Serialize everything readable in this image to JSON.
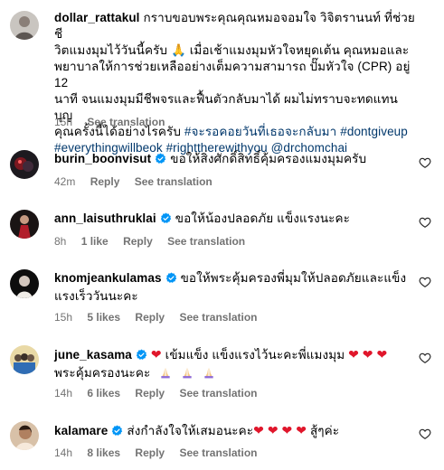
{
  "caption": {
    "username": "dollar_rattakul",
    "text_1": "กราบขอบพระคุณคุณหมอจอมใจ วิจิตรานนท์ ที่ช่วยชี",
    "text_2": "วิตแมงมุมไว้วันนี้ครับ 🙏 เมื่อเช้าแมงมุมหัวใจหยุดเต้น คุณหมอและ",
    "text_3": "พยาบาลให้การช่วยเหลืออย่างเต็มความสามารถ ปั๊มหัวใจ (CPR) อยู่ 12",
    "text_4": "นาที จนแมงมุมมีชีพจรและฟื้นตัวกลับมาได้ ผมไม่ทราบจะทดแทนบุญ",
    "text_5": "คุณครั้งนี้ได้อย่างไรครับ",
    "hashtag_1": "#จะรอคอยวันที่เธอจะกลับมา",
    "hashtag_2": "#dontgiveup",
    "hashtag_3": "#everythingwillbeok",
    "hashtag_4": "#righttherewithyou",
    "mention": "@drchomchai",
    "time": "15h",
    "translation": "See translation"
  },
  "comments": [
    {
      "username": "burin_boonvisut",
      "text": "ขอให้สิ่งศักดิ์สิทธิ์คุ้มครองแมงมุมครับ",
      "time": "42m",
      "reply": "Reply",
      "translation": "See translation"
    },
    {
      "username": "ann_laisuthruklai",
      "text": "ขอให้น้องปลอดภัย แข็งแรงนะคะ",
      "time": "8h",
      "likes": "1 like",
      "reply": "Reply",
      "translation": "See translation"
    },
    {
      "username": "knomjeankulamas",
      "text_1": "ขอให้พระคุ้มครองพี่มุมให้ปลอดภัยและแข็ง",
      "text_2": "แรงเร็ววันนะคะ",
      "time": "15h",
      "likes": "5 likes",
      "reply": "Reply",
      "translation": "See translation"
    },
    {
      "username": "june_kasama",
      "text_1a": "เข้มแข็ง แข็งแรงไว้นะคะพี่แมงมุม",
      "text_2": "พระคุ้มครองนะคะ",
      "time": "14h",
      "likes": "6 likes",
      "reply": "Reply",
      "translation": "See translation"
    },
    {
      "username": "kalamare",
      "text_a": "ส่งกำลังใจให้เสมอนะคะ",
      "text_b": "สู้ๆค่ะ",
      "time": "14h",
      "likes": "8 likes",
      "reply": "Reply",
      "translation": "See translation"
    }
  ],
  "colors": {
    "link": "#00376b",
    "meta": "#737373",
    "verified": "#0095f6",
    "heart_emoji": "#e0162b"
  }
}
